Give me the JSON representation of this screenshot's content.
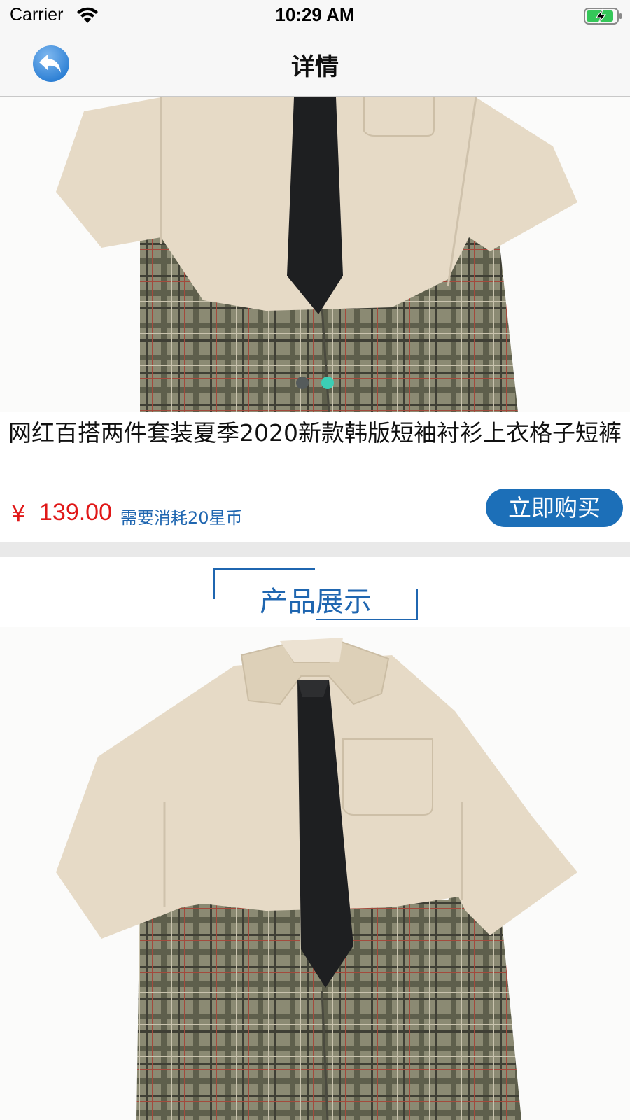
{
  "status_bar": {
    "carrier": "Carrier",
    "time": "10:29 AM"
  },
  "nav": {
    "title": "详情"
  },
  "carousel": {
    "page_count": 2,
    "current_page": 2
  },
  "product": {
    "title": "网红百搭两件套装夏季2020新款韩版短袖衬衫上衣格子短裤",
    "price_symbol": "¥",
    "price": "139.00",
    "star_cost": "需要消耗20星币",
    "buy_label": "立即购买"
  },
  "section": {
    "title": "产品展示"
  },
  "colors": {
    "accent": "#1c6fb8",
    "price": "#e01818",
    "dot_active": "#3ccfb5",
    "dot_inactive": "#555b5b"
  }
}
